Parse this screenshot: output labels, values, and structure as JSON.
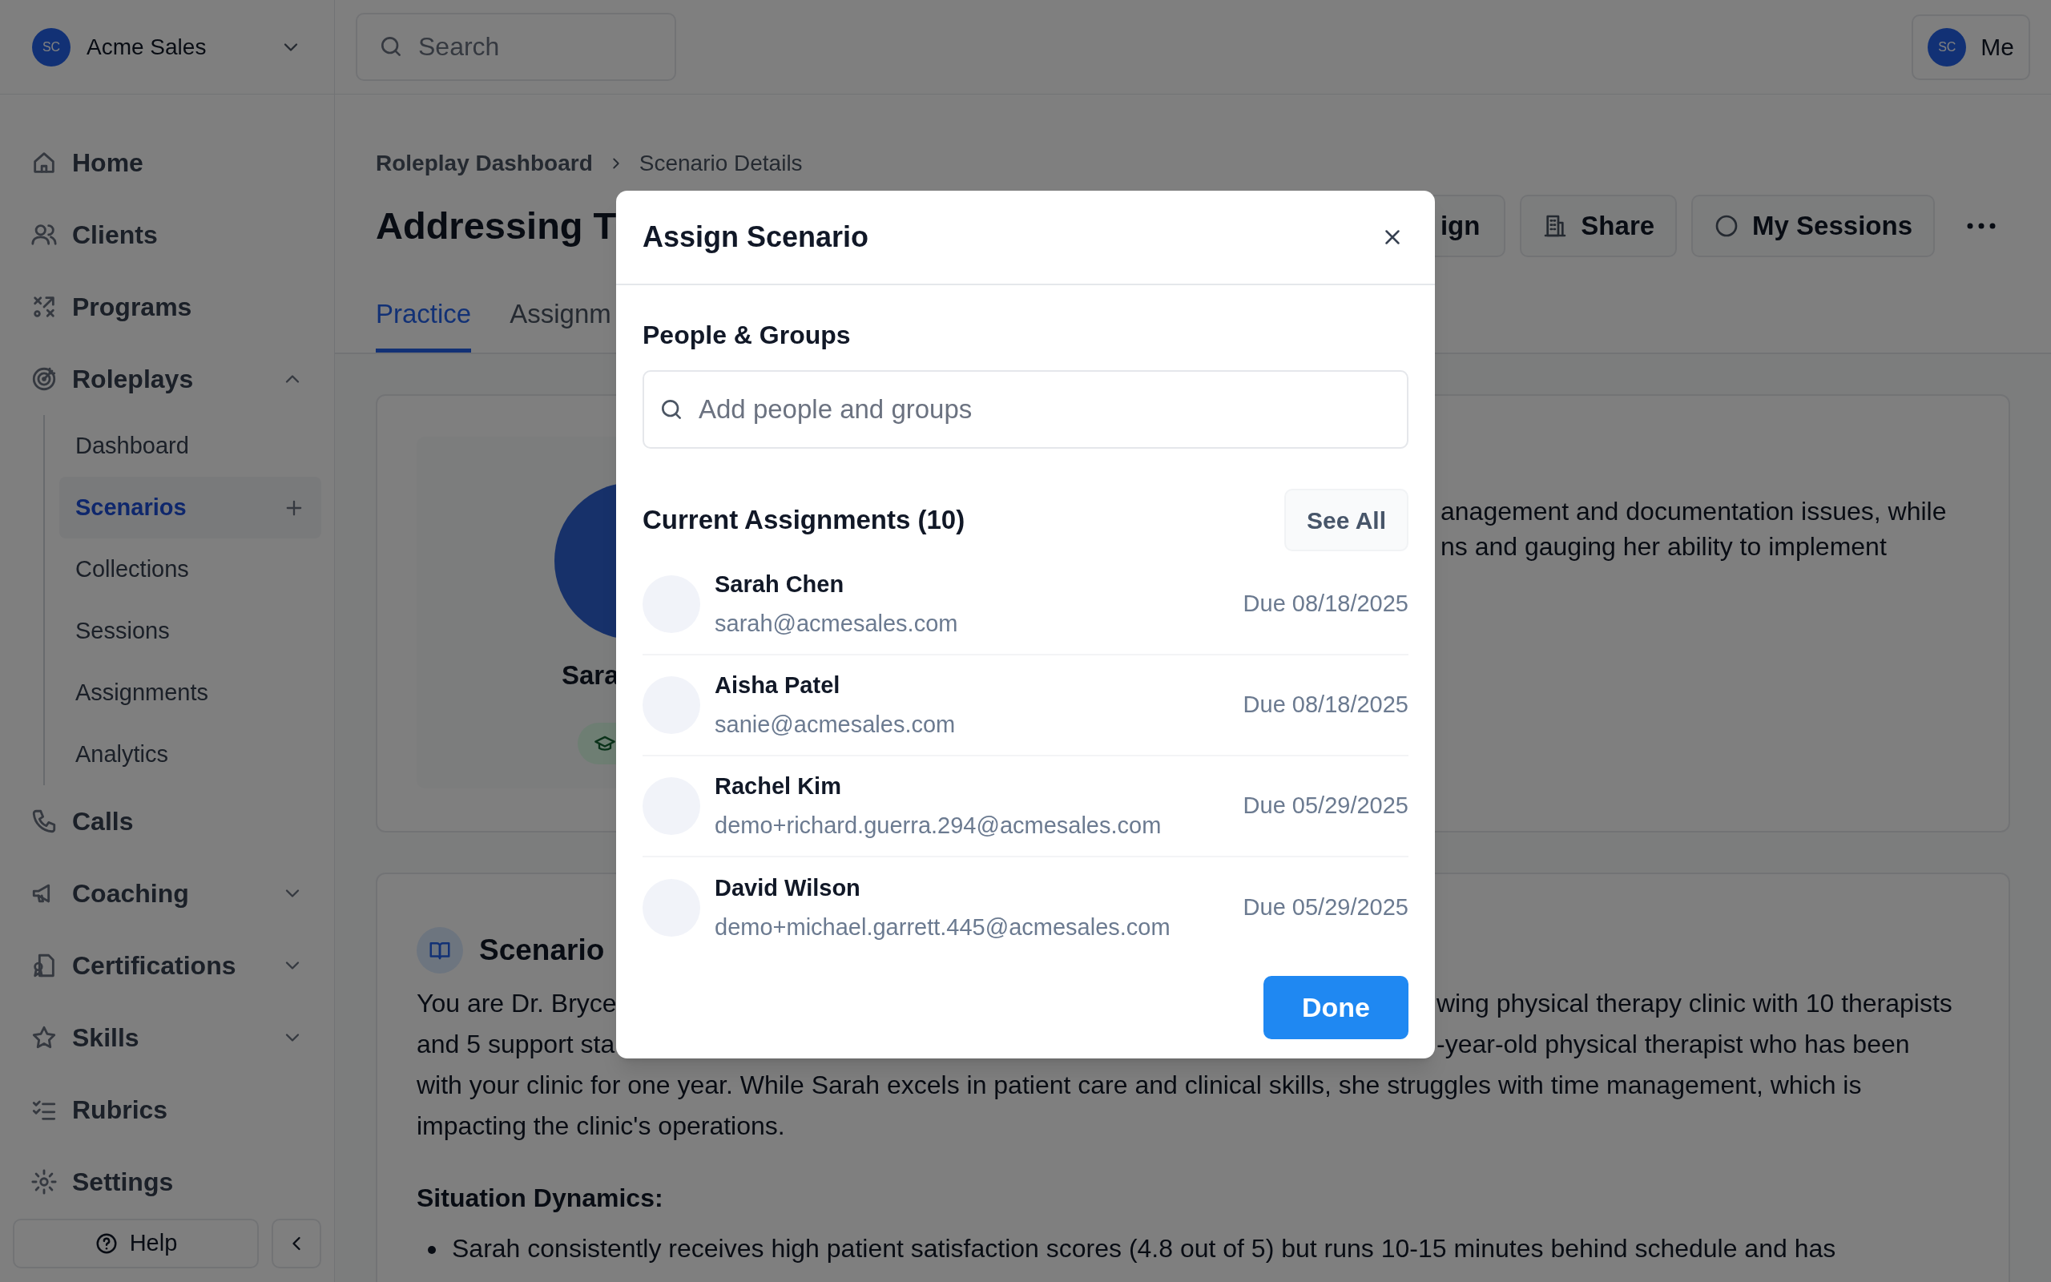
{
  "org": {
    "avatar": "SC",
    "name": "Acme Sales"
  },
  "search": {
    "placeholder": "Search"
  },
  "user": {
    "avatar": "SC",
    "label": "Me"
  },
  "sidebar": {
    "items": [
      {
        "label": "Home"
      },
      {
        "label": "Clients"
      },
      {
        "label": "Programs"
      },
      {
        "label": "Roleplays",
        "expanded": true,
        "children": [
          {
            "label": "Dashboard",
            "selected": false
          },
          {
            "label": "Scenarios",
            "selected": true
          },
          {
            "label": "Collections",
            "selected": false
          },
          {
            "label": "Sessions",
            "selected": false
          },
          {
            "label": "Assignments",
            "selected": false
          },
          {
            "label": "Analytics",
            "selected": false
          }
        ]
      },
      {
        "label": "Calls"
      },
      {
        "label": "Coaching",
        "expanded": false
      },
      {
        "label": "Certifications",
        "expanded": false
      },
      {
        "label": "Skills",
        "expanded": false
      },
      {
        "label": "Rubrics"
      },
      {
        "label": "Settings"
      }
    ],
    "help": "Help"
  },
  "breadcrumb": [
    "Roleplay Dashboard",
    "Scenario Details"
  ],
  "page_title": "Addressing T",
  "actions": [
    {
      "label": "ign"
    },
    {
      "label": "Share"
    },
    {
      "label": "My Sessions"
    }
  ],
  "tabs": [
    {
      "label": "Practice",
      "selected": true
    },
    {
      "label": "Assignm",
      "selected": false
    }
  ],
  "persona": {
    "name": "Sara",
    "description": [
      "anagement and documentation issues, while",
      "ns and gauging her ability to implement"
    ]
  },
  "overview": {
    "title": "Scenario",
    "split_lines": [
      [
        "You are Dr. Bryce",
        "wing physical therapy clinic with 10 therapists"
      ],
      [
        "and 5 support sta",
        "-year-old physical therapist who has been"
      ]
    ],
    "paragraph": "with your clinic for one year. While Sarah excels in patient care and clinical skills, she struggles with time management, which is impacting the clinic's operations.",
    "heading": "Situation Dynamics:",
    "bullets": [
      "Sarah consistently receives high patient satisfaction scores (4.8 out of 5) but runs 10-15 minutes behind schedule and has"
    ]
  },
  "modal": {
    "title": "Assign Scenario",
    "section": "People & Groups",
    "input": {
      "placeholder": "Add people and groups"
    },
    "assignments_title": "Current Assignments (10)",
    "see_all": "See All",
    "assignments": [
      {
        "name": "Sarah Chen",
        "email": "sarah@acmesales.com",
        "due": "Due 08/18/2025"
      },
      {
        "name": "Aisha Patel",
        "email": "sanie@acmesales.com",
        "due": "Due 08/18/2025"
      },
      {
        "name": "Rachel Kim",
        "email": "demo+richard.guerra.294@acmesales.com",
        "due": "Due 05/29/2025"
      },
      {
        "name": "David Wilson",
        "email": "demo+michael.garrett.445@acmesales.com",
        "due": "Due 05/29/2025"
      }
    ],
    "done": "Done"
  }
}
